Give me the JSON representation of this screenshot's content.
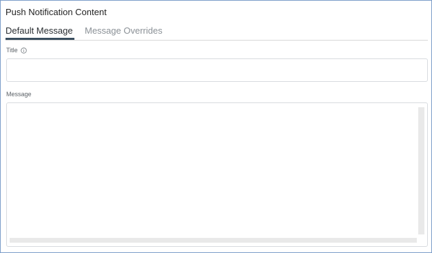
{
  "panel": {
    "title": "Push Notification Content"
  },
  "tabs": [
    {
      "label": "Default Message",
      "active": true
    },
    {
      "label": "Message Overrides",
      "active": false
    }
  ],
  "fields": {
    "title": {
      "label": "Title",
      "value": "",
      "icon": "info-icon"
    },
    "message": {
      "label": "Message",
      "value": ""
    }
  },
  "colors": {
    "active_tab_underline": "#3a4e5e",
    "panel_border": "#7b9cc9",
    "inactive_tab_text": "#8a9096"
  }
}
